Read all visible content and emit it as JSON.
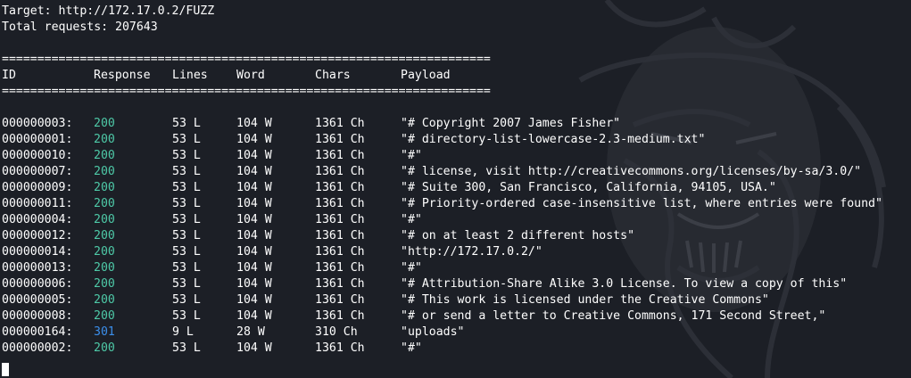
{
  "target_line": "Target: http://172.17.0.2/FUZZ",
  "total_line": "Total requests: 207643",
  "separator": "=====================================================================",
  "headers": {
    "id": "ID",
    "response": "Response",
    "lines": "Lines",
    "word": "Word",
    "chars": "Chars",
    "payload": "Payload"
  },
  "rows": [
    {
      "id": "000000003:",
      "response": "200",
      "lines": "53 L",
      "word": "104 W",
      "chars": "1361 Ch",
      "payload": "\"# Copyright 2007 James Fisher\""
    },
    {
      "id": "000000001:",
      "response": "200",
      "lines": "53 L",
      "word": "104 W",
      "chars": "1361 Ch",
      "payload": "\"# directory-list-lowercase-2.3-medium.txt\""
    },
    {
      "id": "000000010:",
      "response": "200",
      "lines": "53 L",
      "word": "104 W",
      "chars": "1361 Ch",
      "payload": "\"#\""
    },
    {
      "id": "000000007:",
      "response": "200",
      "lines": "53 L",
      "word": "104 W",
      "chars": "1361 Ch",
      "payload": "\"# license, visit http://creativecommons.org/licenses/by-sa/3.0/\""
    },
    {
      "id": "000000009:",
      "response": "200",
      "lines": "53 L",
      "word": "104 W",
      "chars": "1361 Ch",
      "payload": "\"# Suite 300, San Francisco, California, 94105, USA.\""
    },
    {
      "id": "000000011:",
      "response": "200",
      "lines": "53 L",
      "word": "104 W",
      "chars": "1361 Ch",
      "payload": "\"# Priority-ordered case-insensitive list, where entries were found\""
    },
    {
      "id": "000000004:",
      "response": "200",
      "lines": "53 L",
      "word": "104 W",
      "chars": "1361 Ch",
      "payload": "\"#\""
    },
    {
      "id": "000000012:",
      "response": "200",
      "lines": "53 L",
      "word": "104 W",
      "chars": "1361 Ch",
      "payload": "\"# on at least 2 different hosts\""
    },
    {
      "id": "000000014:",
      "response": "200",
      "lines": "53 L",
      "word": "104 W",
      "chars": "1361 Ch",
      "payload": "\"http://172.17.0.2/\""
    },
    {
      "id": "000000013:",
      "response": "200",
      "lines": "53 L",
      "word": "104 W",
      "chars": "1361 Ch",
      "payload": "\"#\""
    },
    {
      "id": "000000006:",
      "response": "200",
      "lines": "53 L",
      "word": "104 W",
      "chars": "1361 Ch",
      "payload": "\"# Attribution-Share Alike 3.0 License. To view a copy of this\""
    },
    {
      "id": "000000005:",
      "response": "200",
      "lines": "53 L",
      "word": "104 W",
      "chars": "1361 Ch",
      "payload": "\"# This work is licensed under the Creative Commons\""
    },
    {
      "id": "000000008:",
      "response": "200",
      "lines": "53 L",
      "word": "104 W",
      "chars": "1361 Ch",
      "payload": "\"# or send a letter to Creative Commons, 171 Second Street,\""
    },
    {
      "id": "000000164:",
      "response": "301",
      "lines": "9 L",
      "word": "28 W",
      "chars": "310 Ch",
      "payload": "\"uploads\""
    },
    {
      "id": "000000002:",
      "response": "200",
      "lines": "53 L",
      "word": "104 W",
      "chars": "1361 Ch",
      "payload": "\"#\""
    }
  ],
  "colors": {
    "background": "#1c1f26",
    "text": "#ffffff",
    "status_200": "#4ec9a7",
    "status_301": "#3b8eea"
  }
}
